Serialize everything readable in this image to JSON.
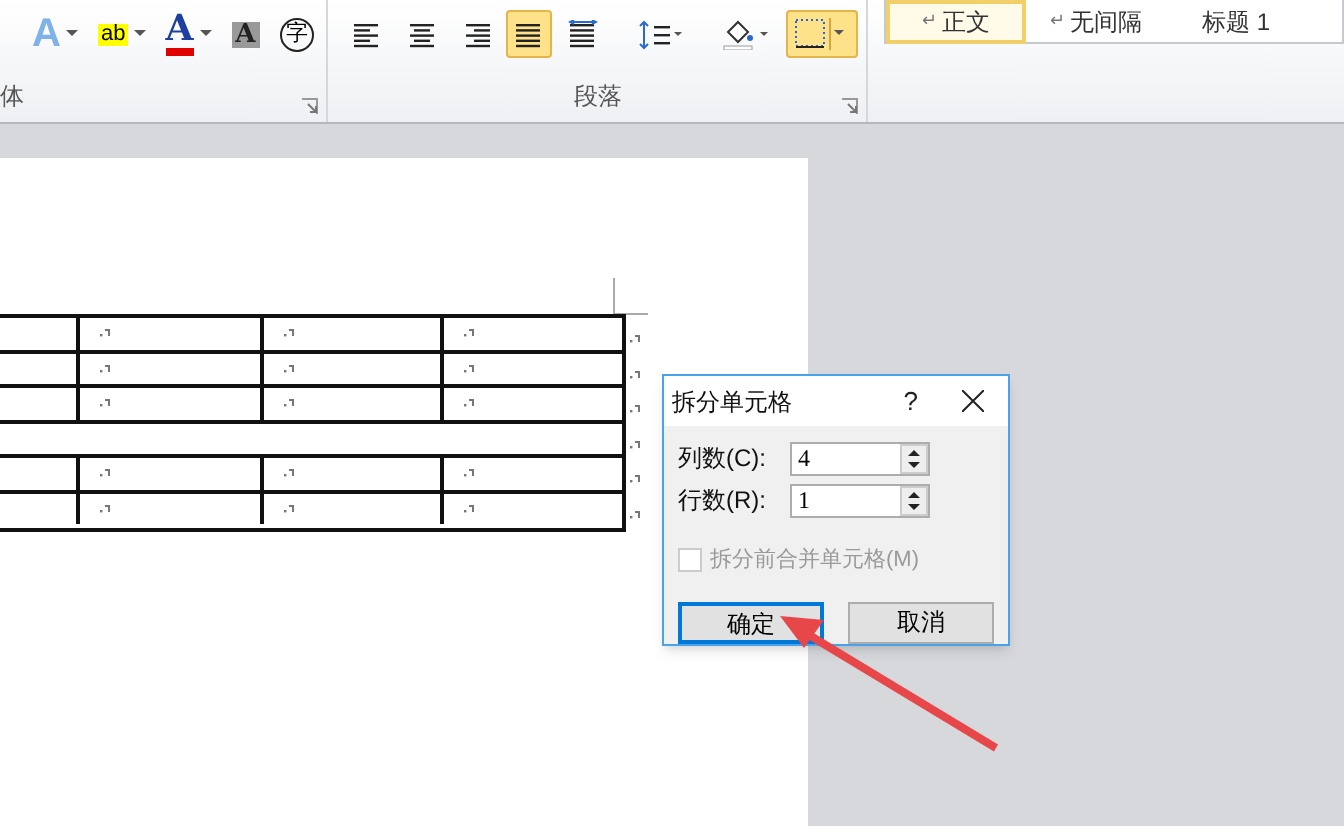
{
  "ribbon": {
    "font_group": {
      "label": "体",
      "tools": [
        {
          "kind": "text-effect",
          "glyph": "A",
          "dropdown": true
        },
        {
          "kind": "highlight",
          "glyph": "ab",
          "dropdown": true
        },
        {
          "kind": "font-color",
          "glyph": "A",
          "dropdown": true
        },
        {
          "kind": "shading",
          "glyph": "A",
          "dropdown": false
        },
        {
          "kind": "enclose",
          "glyph": "字",
          "dropdown": false
        }
      ]
    },
    "paragraph_group": {
      "label": "段落",
      "tools": [
        {
          "kind": "align-left",
          "selected": false
        },
        {
          "kind": "align-center",
          "selected": false
        },
        {
          "kind": "align-right",
          "selected": false
        },
        {
          "kind": "justify",
          "selected": true
        },
        {
          "kind": "distribute",
          "selected": false
        },
        {
          "kind": "line-spacing",
          "selected": false
        },
        {
          "kind": "fill",
          "selected": false
        },
        {
          "kind": "borders",
          "selected": true
        }
      ]
    },
    "styles": [
      {
        "mark": "↵",
        "label": "正文",
        "selected": true
      },
      {
        "mark": "↵",
        "label": "无间隔",
        "selected": false
      },
      {
        "label": "标题 1",
        "selected": false
      }
    ]
  },
  "table": {
    "rows": [
      {
        "kind": "split"
      },
      {
        "kind": "split"
      },
      {
        "kind": "split"
      },
      {
        "kind": "merged"
      },
      {
        "kind": "split"
      },
      {
        "kind": "split"
      }
    ]
  },
  "dialog": {
    "title": "拆分单元格",
    "help": "?",
    "fields": [
      {
        "label": "列数(C):",
        "value": "4"
      },
      {
        "label": "行数(R):",
        "value": "1"
      }
    ],
    "checkbox": {
      "label": "拆分前合并单元格(M)",
      "checked": false,
      "disabled": true
    },
    "buttons": [
      {
        "label": "确定",
        "selected": true
      },
      {
        "label": "取消",
        "selected": false
      }
    ]
  }
}
